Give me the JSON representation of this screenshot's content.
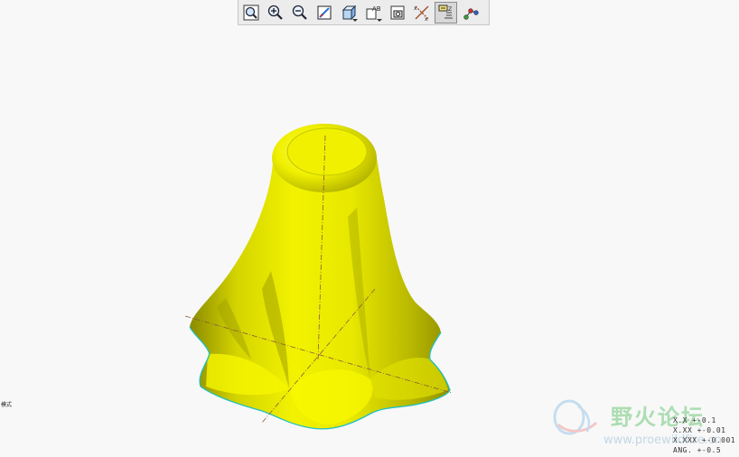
{
  "toolbar": {
    "buttons": [
      {
        "icon": "refit-icon"
      },
      {
        "icon": "zoom-in-icon"
      },
      {
        "icon": "zoom-out-icon"
      },
      {
        "icon": "repaint-icon"
      },
      {
        "icon": "display-style-icon"
      },
      {
        "icon": "saved-views-icon"
      },
      {
        "icon": "view-manager-icon"
      },
      {
        "icon": "datum-display-icon"
      },
      {
        "icon": "annotation-display-icon",
        "active": true
      },
      {
        "icon": "spin-center-icon"
      }
    ]
  },
  "viewport": {
    "left_label": "模式",
    "model_color": "#e8e800",
    "edge_color": "#20c0c0"
  },
  "tolerance": {
    "lines": [
      "X.X +-0.1",
      "X.XX +-0.01",
      "X.XXX +-0.001",
      "ANG. +-0.5"
    ]
  },
  "watermark": {
    "name": "野火论坛",
    "url": "www.proewildfire.cn"
  }
}
